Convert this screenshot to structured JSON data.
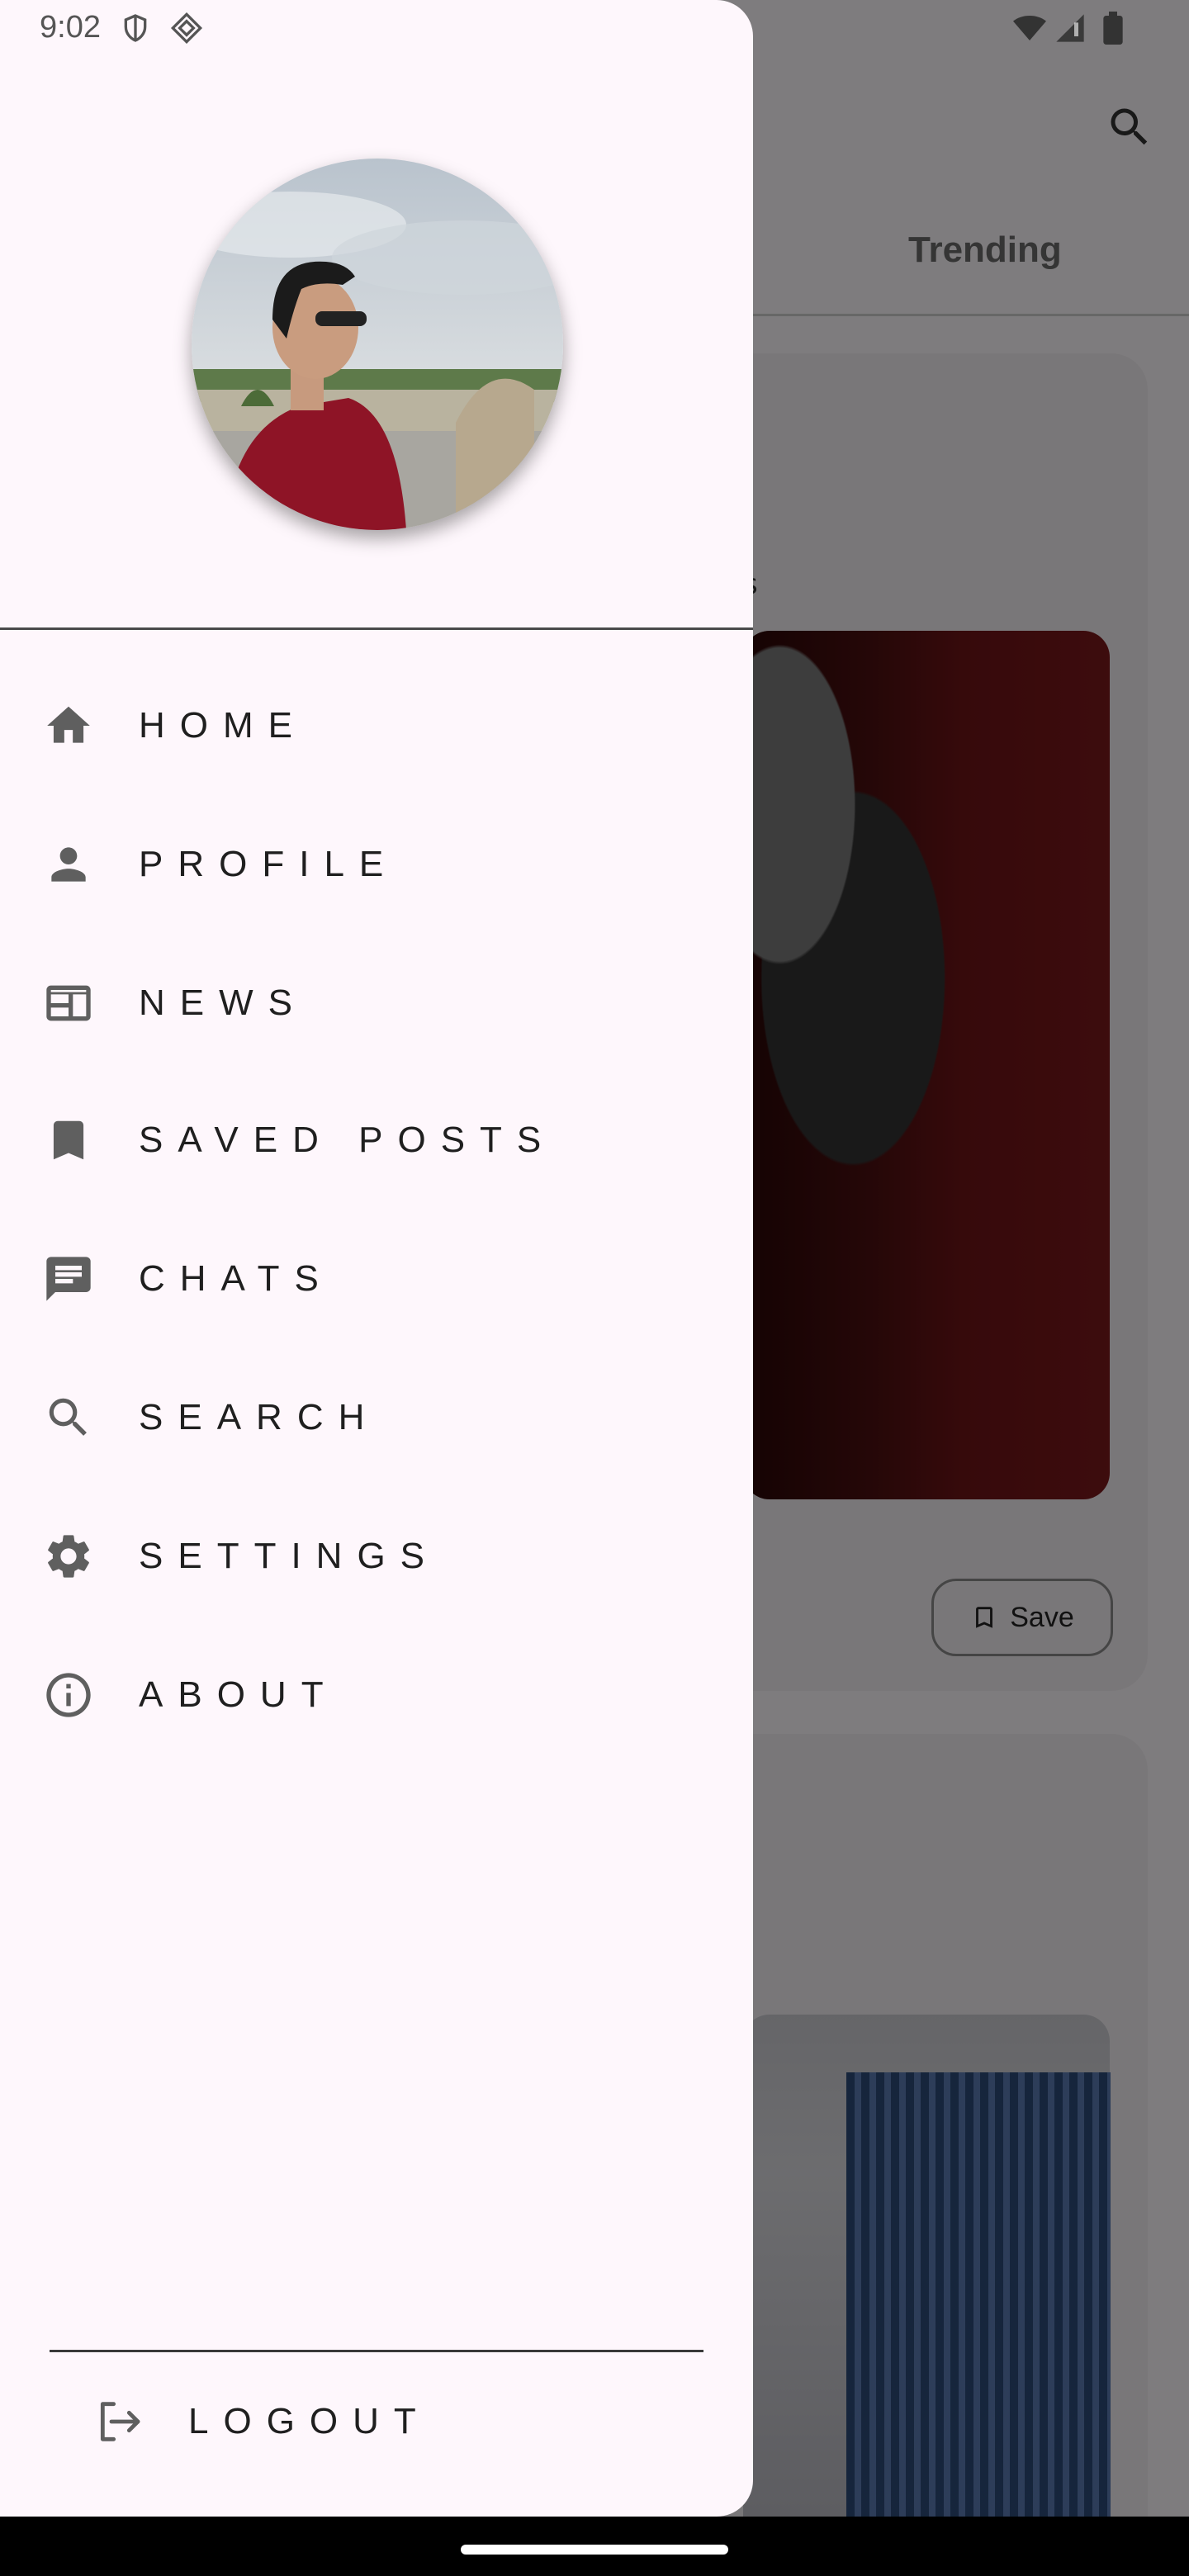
{
  "status_bar": {
    "time": "9:02",
    "left_icons": [
      "shield-icon",
      "diamond-icon"
    ],
    "right_icons": [
      "wifi-icon",
      "signal-icon",
      "battery-icon"
    ]
  },
  "background": {
    "tab_trending": "Trending",
    "card1_fragment": "s",
    "save_label": "Save"
  },
  "drawer": {
    "avatar_alt": "Profile photo",
    "items": [
      {
        "label": "HOME",
        "icon": "home-icon"
      },
      {
        "label": "PROFILE",
        "icon": "person-icon"
      },
      {
        "label": "NEWS",
        "icon": "newspaper-icon"
      },
      {
        "label": "SAVED POSTS",
        "icon": "bookmark-icon"
      },
      {
        "label": "CHATS",
        "icon": "chat-icon"
      },
      {
        "label": "SEARCH",
        "icon": "search-icon"
      },
      {
        "label": "SETTINGS",
        "icon": "gear-icon"
      },
      {
        "label": "ABOUT",
        "icon": "info-icon"
      }
    ],
    "logout_label": "LOGOUT"
  },
  "colors": {
    "drawer_bg": "#fef7fc",
    "icon_color": "#5f5f5f",
    "scrim": "rgba(0,0,0,0.5)"
  }
}
